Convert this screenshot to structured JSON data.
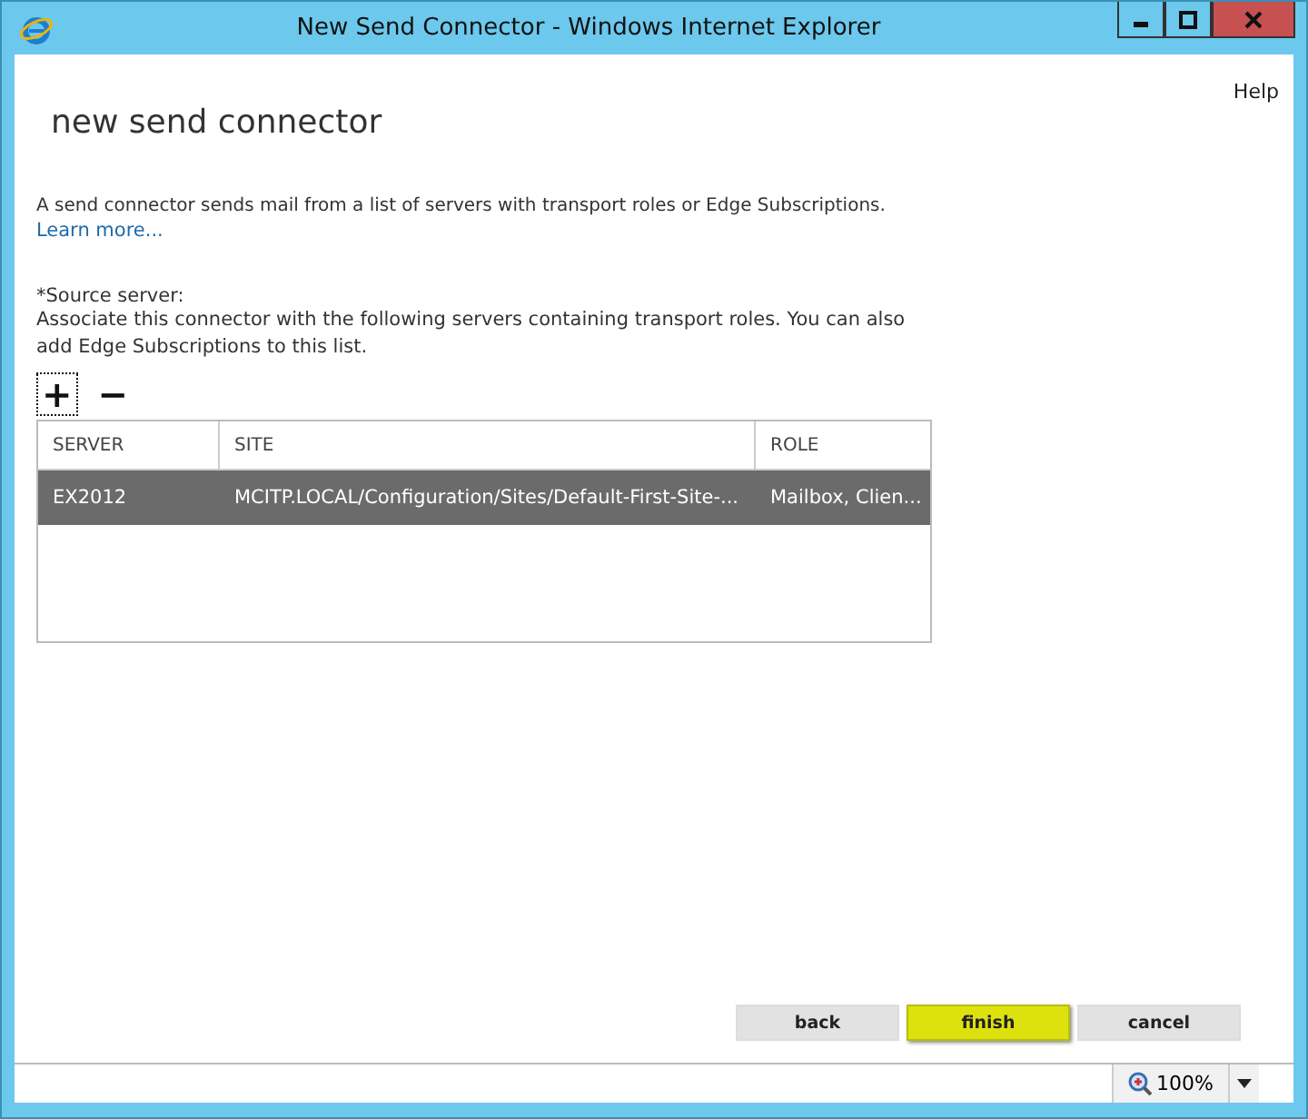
{
  "window": {
    "title": "New Send Connector - Windows Internet Explorer"
  },
  "help": "Help",
  "heading": "new send connector",
  "description": "A send connector sends mail from a list of servers with transport roles or Edge Subscriptions.",
  "learn_more": "Learn more...",
  "source_label": "*Source server:",
  "source_hint": "Associate this connector with the following servers containing transport roles. You can also add Edge Subscriptions to this list.",
  "toolbar": [
    "+",
    "−"
  ],
  "table": {
    "columns": [
      "SERVER",
      "SITE",
      "ROLE"
    ],
    "rows": [
      {
        "cells": [
          "EX2012",
          "MCITP.LOCAL/Configuration/Sites/Default-First-Site-...",
          "Mailbox, Clien..."
        ],
        "selected": true
      }
    ]
  },
  "buttons": [
    {
      "label": "back",
      "kind": "normal"
    },
    {
      "label": "finish",
      "kind": "primary"
    },
    {
      "label": "cancel",
      "kind": "normal"
    }
  ],
  "status_bar": {
    "zoom": "100%"
  }
}
